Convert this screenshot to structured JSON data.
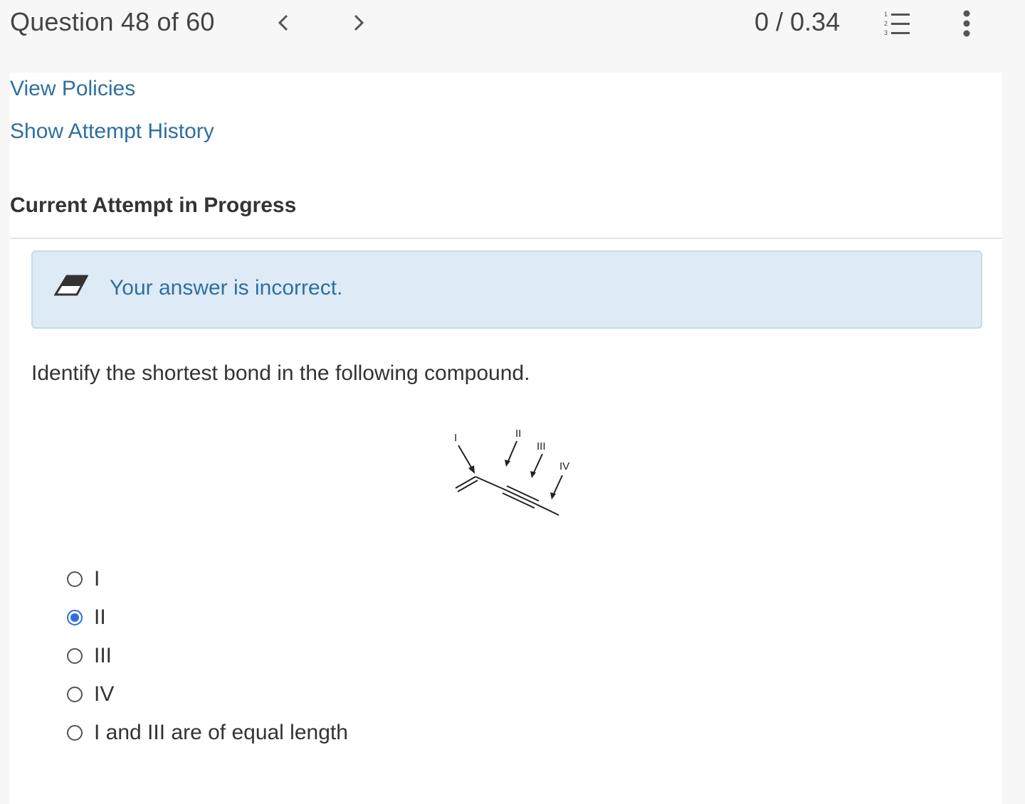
{
  "header": {
    "question_counter": "Question 48 of 60",
    "score": "0 / 0.34",
    "prev_icon": "chevron-left-icon",
    "next_icon": "chevron-right-icon",
    "list_icon": "numbered-list-icon",
    "more_icon": "more-vertical-icon"
  },
  "links": {
    "view_policies": "View Policies",
    "show_attempt_history": "Show Attempt History"
  },
  "attempt": {
    "heading": "Current Attempt in Progress"
  },
  "feedback": {
    "icon": "eraser-icon",
    "message": "Your answer is incorrect."
  },
  "question": {
    "prompt": "Identify the shortest bond in the following compound.",
    "diagram_labels": [
      "I",
      "II",
      "III",
      "IV"
    ]
  },
  "choices": [
    {
      "label": "I",
      "selected": false
    },
    {
      "label": "II",
      "selected": true
    },
    {
      "label": "III",
      "selected": false
    },
    {
      "label": "IV",
      "selected": false
    },
    {
      "label": "I and III are of equal length",
      "selected": false
    }
  ],
  "colors": {
    "link": "#2f6f9f",
    "feedback_bg": "#deebf6",
    "selected_radio": "#2f6fd8"
  }
}
